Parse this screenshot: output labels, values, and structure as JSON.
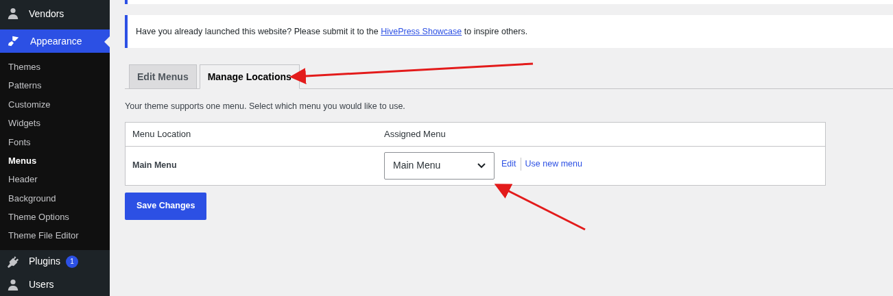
{
  "sidebar": {
    "items": [
      {
        "label": "Vendors",
        "kind": "person",
        "selected": false
      },
      {
        "label": "Appearance",
        "kind": "brush",
        "selected": true,
        "children": [
          {
            "label": "Themes",
            "selected": false
          },
          {
            "label": "Patterns",
            "selected": false
          },
          {
            "label": "Customize",
            "selected": false
          },
          {
            "label": "Widgets",
            "selected": false
          },
          {
            "label": "Fonts",
            "selected": false
          },
          {
            "label": "Menus",
            "selected": true
          },
          {
            "label": "Header",
            "selected": false
          },
          {
            "label": "Background",
            "selected": false
          },
          {
            "label": "Theme Options",
            "selected": false
          },
          {
            "label": "Theme File Editor",
            "selected": false
          }
        ]
      },
      {
        "label": "Plugins",
        "kind": "plug",
        "selected": false,
        "badge": "1"
      },
      {
        "label": "Users",
        "kind": "person",
        "selected": false
      }
    ]
  },
  "notice": {
    "before": "Have you already launched this website? Please submit it to the ",
    "link": "HivePress Showcase",
    "after": " to inspire others."
  },
  "tabs": [
    {
      "label": "Edit Menus",
      "selected": false
    },
    {
      "label": "Manage Locations",
      "selected": true
    }
  ],
  "description": "Your theme supports one menu. Select which menu you would like to use.",
  "table": {
    "columns": [
      "Menu Location",
      "Assigned Menu"
    ],
    "rows": [
      {
        "location": "Main Menu",
        "menu": "Main Menu",
        "links": [
          "Edit",
          "Use new menu"
        ]
      }
    ]
  },
  "save_button": "Save Changes"
}
